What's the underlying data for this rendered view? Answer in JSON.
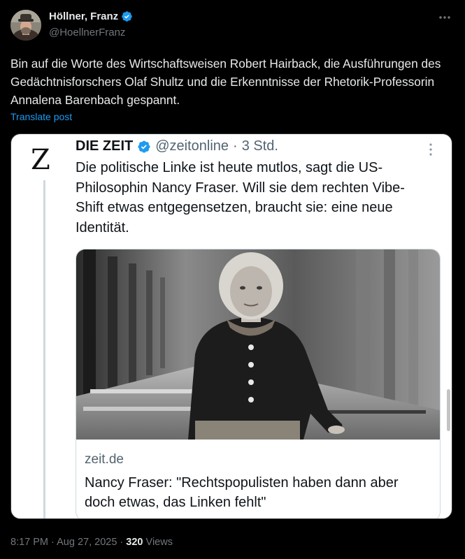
{
  "post": {
    "author": {
      "name": "Höllner, Franz",
      "handle": "@HoellnerFranz",
      "verified": true,
      "avatar_icon": "person-with-hat-avatar"
    },
    "text": "Bin auf die Worte des Wirtschaftsweisen Robert Hairback, die Ausführungen des Gedächtnisforschers Olaf Shultz und die Erkenntnisse der Rhetorik-Professorin Annalena Barenbach gespannt.",
    "translate_label": "Translate post",
    "more_icon": "more-horizontal-icon",
    "meta": {
      "time": "8:17 PM",
      "separator": "·",
      "date": "Aug 27, 2025",
      "views_count": "320",
      "views_label": "Views"
    }
  },
  "quote": {
    "logo_text": "Z",
    "name": "DIE ZEIT",
    "verified": true,
    "handle": "@zeitonline",
    "separator": "·",
    "time": "3 Std.",
    "more_icon": "more-vertical-icon",
    "text": "Die politische Linke ist heute mutlos, sagt die US-Philosophin Nancy Fraser. Will sie dem rechten Vibe-Shift etwas entgegensetzen, braucht sie: eine neue Identität.",
    "link_card": {
      "image": "photo-woman-in-dark-jacket",
      "domain": "zeit.de",
      "title": "Nancy Fraser: \"Rechtspopulisten haben dann aber doch etwas, das Linken fehlt\""
    }
  },
  "colors": {
    "background": "#000000",
    "text_primary": "#e7e9ea",
    "text_secondary": "#71767b",
    "link": "#1d9bf0",
    "verified": "#1d9bf0",
    "card_background": "#ffffff"
  }
}
